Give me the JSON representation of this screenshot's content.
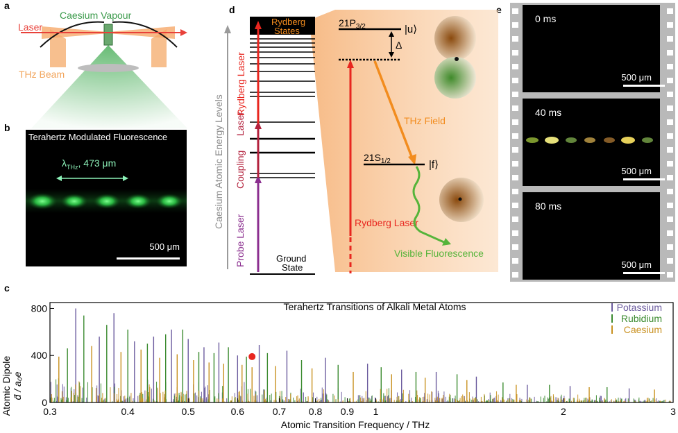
{
  "panels": {
    "a": "a",
    "b": "b",
    "c": "c",
    "d": "d",
    "e": "e"
  },
  "panel_a": {
    "label_vapour": "Caesium Vapour",
    "label_laser": "Laser",
    "label_thz": "THz Beam",
    "colors": {
      "laser": "#e8413a",
      "thz": "#f2a55c",
      "vapour": "#5aa86a"
    }
  },
  "panel_b": {
    "caption": "Terahertz Modulated Fluorescence",
    "lambda_label": "λTHz, 473 μm",
    "lambda_symbol": "λ",
    "lambda_sub": "THz",
    "lambda_value": ", 473 μm",
    "scale_label": "500 μm"
  },
  "panel_d": {
    "y_axis_label": "Caesium Atomic Energy Levels",
    "rydberg_states": "Rydberg States",
    "rydberg_laser_left": "Rydberg Laser",
    "coupling_laser_a": "Coupling",
    "coupling_laser_b": "Laser",
    "probe_laser": "Probe Laser",
    "ground_state_a": "Ground",
    "ground_state_b": "State",
    "upper_state": "21P3/2",
    "upper_state_main": "21P",
    "upper_state_sub": "3/2",
    "upper_ket": "|u⟩",
    "detuning": "Δ",
    "thz_field": "THz Field",
    "lower_state_main": "21S",
    "lower_state_sub": "1/2",
    "lower_ket": "|f⟩",
    "rydberg_laser_right": "Rydberg Laser",
    "visible_fluorescence": "Visible Fluorescence",
    "colors": {
      "rydberg": "#e8261f",
      "coupling": "#b3223d",
      "probe": "#8b2f8f",
      "thz": "#f28c1e",
      "fluor": "#56b43a",
      "states": "#e07b1f"
    }
  },
  "panel_e": {
    "frames": [
      {
        "time": "0 ms",
        "scale": "500 μm"
      },
      {
        "time": "40 ms",
        "scale": "500 μm"
      },
      {
        "time": "80 ms",
        "scale": "500 μm"
      }
    ]
  },
  "chart_data": {
    "type": "bar",
    "title": "Terahertz Transitions of Alkali Metal Atoms",
    "xlabel": "Atomic Transition Frequency / THz",
    "ylabel_line1": "Atomic Dipole",
    "ylabel_line2": "d̄ / a₀e",
    "x_scale": "log",
    "xlim": [
      0.3,
      3
    ],
    "ylim": [
      0,
      850
    ],
    "x_ticks": [
      0.3,
      0.4,
      0.5,
      0.6,
      0.7,
      0.8,
      0.9,
      1,
      2,
      3
    ],
    "x_tick_labels": [
      "0.3",
      "0.4",
      "0.5",
      "0.6",
      "0.7",
      "0.8",
      "0.9",
      "1",
      "2",
      "3"
    ],
    "y_ticks": [
      0,
      400,
      800
    ],
    "y_tick_labels": [
      "0",
      "400",
      "800"
    ],
    "legend_position": "top-right",
    "highlight": {
      "x": 0.633,
      "y": 390,
      "color": "#e8261f"
    },
    "series": [
      {
        "name": "Potassium",
        "color": "#6b5b9e",
        "peaks": [
          [
            0.33,
            800
          ],
          [
            0.36,
            560
          ],
          [
            0.38,
            760
          ],
          [
            0.41,
            520
          ],
          [
            0.44,
            560
          ],
          [
            0.47,
            620
          ],
          [
            0.5,
            540
          ],
          [
            0.53,
            470
          ],
          [
            0.56,
            510
          ],
          [
            0.6,
            400
          ],
          [
            0.65,
            490
          ],
          [
            0.72,
            440
          ],
          [
            0.83,
            380
          ],
          [
            0.97,
            330
          ],
          [
            1.1,
            280
          ],
          [
            1.25,
            260
          ],
          [
            1.45,
            220
          ],
          [
            1.75,
            150
          ],
          [
            2.05,
            140
          ],
          [
            2.55,
            120
          ]
        ]
      },
      {
        "name": "Rubidium",
        "color": "#3a8a2e",
        "peaks": [
          [
            0.32,
            460
          ],
          [
            0.34,
            740
          ],
          [
            0.37,
            660
          ],
          [
            0.4,
            620
          ],
          [
            0.43,
            500
          ],
          [
            0.46,
            580
          ],
          [
            0.49,
            620
          ],
          [
            0.52,
            430
          ],
          [
            0.55,
            420
          ],
          [
            0.58,
            470
          ],
          [
            0.62,
            390
          ],
          [
            0.67,
            420
          ],
          [
            0.76,
            360
          ],
          [
            0.87,
            320
          ],
          [
            1.02,
            300
          ],
          [
            1.16,
            260
          ],
          [
            1.35,
            240
          ],
          [
            1.6,
            170
          ],
          [
            1.9,
            150
          ],
          [
            2.35,
            130
          ]
        ]
      },
      {
        "name": "Caesium",
        "color": "#c8901e",
        "peaks": [
          [
            0.31,
            390
          ],
          [
            0.35,
            480
          ],
          [
            0.39,
            430
          ],
          [
            0.42,
            450
          ],
          [
            0.45,
            380
          ],
          [
            0.48,
            410
          ],
          [
            0.51,
            360
          ],
          [
            0.54,
            340
          ],
          [
            0.57,
            330
          ],
          [
            0.61,
            320
          ],
          [
            0.633,
            300
          ],
          [
            0.69,
            310
          ],
          [
            0.79,
            290
          ],
          [
            0.92,
            260
          ],
          [
            1.06,
            240
          ],
          [
            1.2,
            210
          ],
          [
            1.4,
            190
          ],
          [
            1.68,
            150
          ],
          [
            2.2,
            130
          ],
          [
            2.8,
            110
          ]
        ]
      }
    ]
  }
}
